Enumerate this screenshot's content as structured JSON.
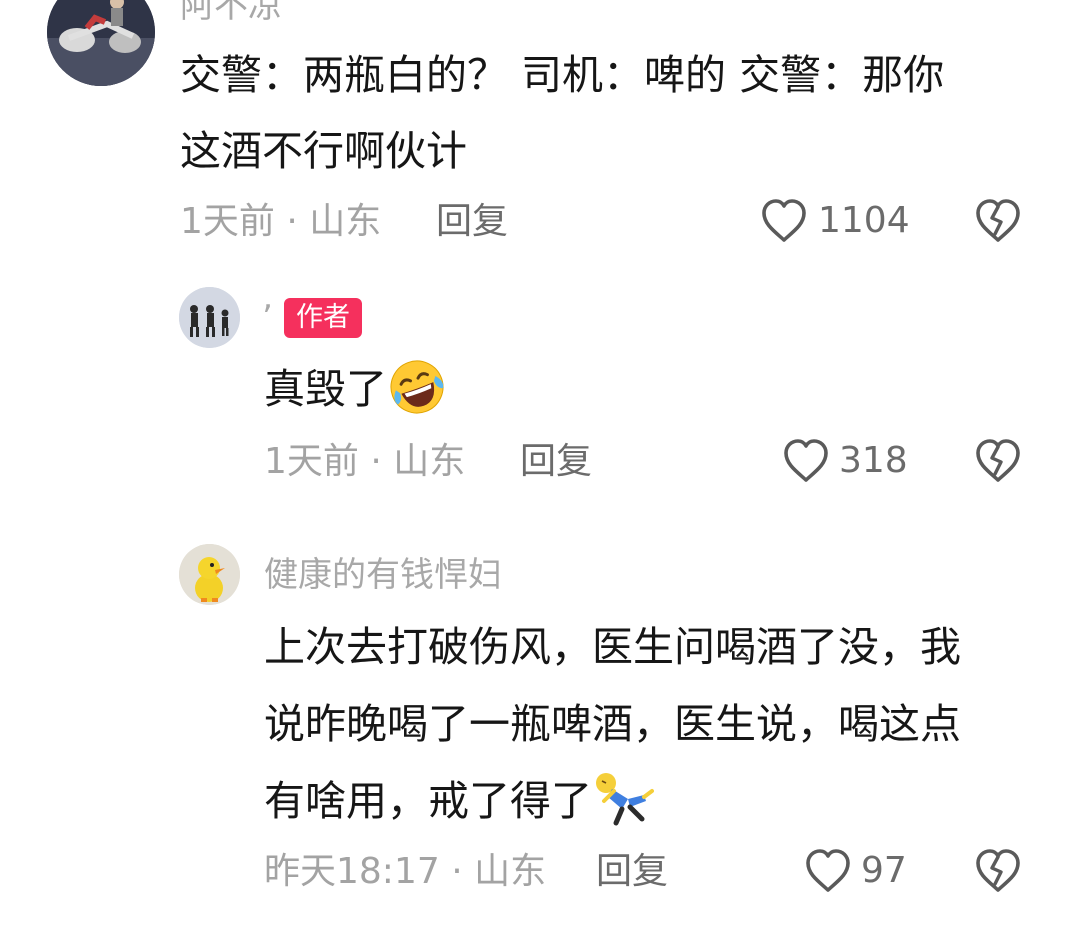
{
  "comments": [
    {
      "username": "阿不凉",
      "lines": [
        "交警：两瓶白的？ 司机：啤的 交警：那你",
        "这酒不行啊伙计"
      ],
      "time_location": "1天前 · 山东",
      "reply_label": "回复",
      "like_count": "1104"
    },
    {
      "username": "’",
      "badge": "作者",
      "lines": [
        "真毁了"
      ],
      "emoji": "rolling-on-floor-laughing-emoji",
      "time_location": "1天前 · 山东",
      "reply_label": "回复",
      "like_count": "318"
    },
    {
      "username": "健康的有钱悍妇",
      "lines": [
        "上次去打破伤风，医生问喝酒了没，我",
        "说昨晚喝了一瓶啤酒，医生说，喝这点",
        "有啥用，戒了得了"
      ],
      "emoji": "lying-figure-sticker",
      "time_location": "昨天18:17 · 山东",
      "reply_label": "回复",
      "like_count": "97"
    }
  ],
  "icons": {
    "like": "heart-outline-icon",
    "dislike": "broken-heart-icon"
  },
  "colors": {
    "badge": "#f5305d",
    "meta": "#a3a3a3",
    "text": "#161616"
  }
}
